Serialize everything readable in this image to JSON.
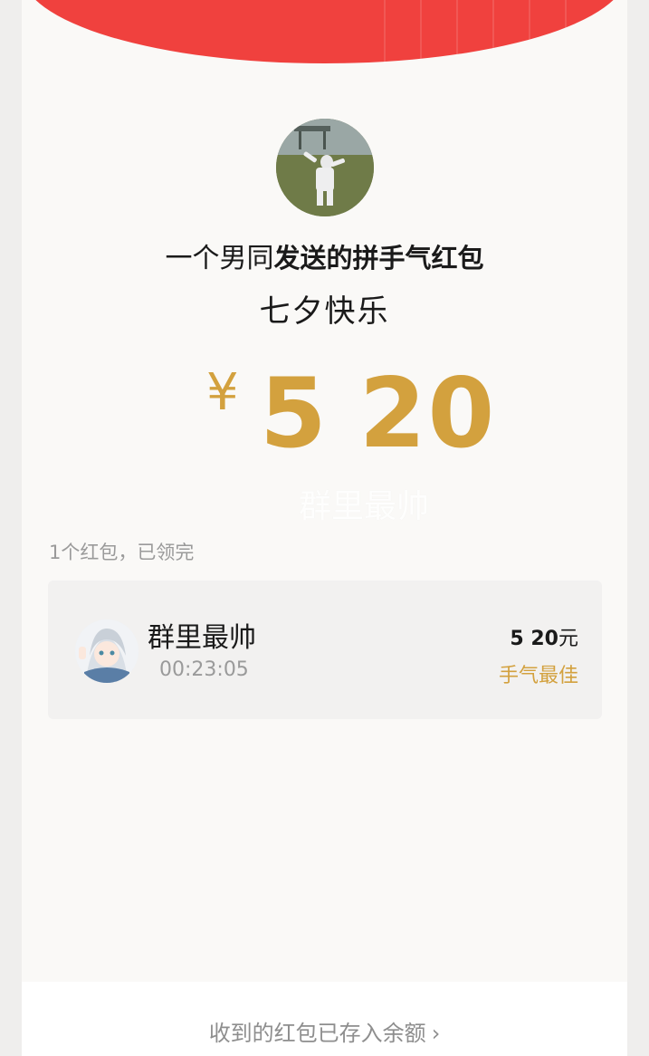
{
  "header": {
    "sender_name": "一个男同",
    "title_suffix": "发送的拼手气红包",
    "wish": "七夕快乐"
  },
  "amount": {
    "currency": "¥",
    "value_int": "5",
    "value_dec": "20"
  },
  "watermark": "群里最帅",
  "summary": "1个红包，已领完",
  "records": [
    {
      "name": "群里最帅",
      "time": "00:23:05",
      "amount_int": "5",
      "amount_dec": "20",
      "unit": "元",
      "badge": "手气最佳"
    }
  ],
  "footer": {
    "link": "收到的红包已存入余额",
    "chevron": "chevron-right-icon"
  },
  "colors": {
    "red": "#f0413e",
    "gold": "#d3a13e"
  }
}
